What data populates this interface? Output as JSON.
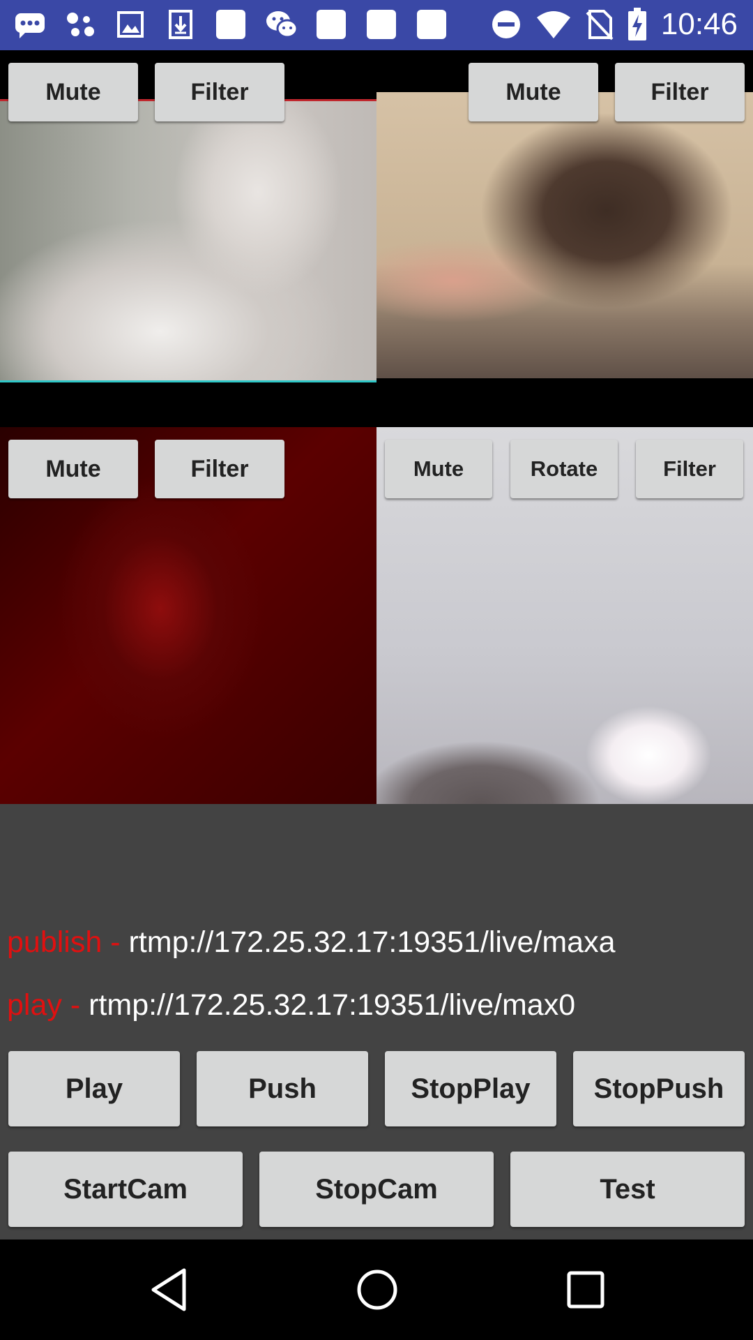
{
  "status_bar": {
    "time": "10:46",
    "left_icons": [
      "message-notification-icon",
      "google-assistant-icon",
      "gallery-icon",
      "download-icon",
      "blank-notification-icon",
      "wechat-icon",
      "blank-notification-icon",
      "blank-notification-icon",
      "blank-notification-icon"
    ],
    "right_icons": [
      "do-not-disturb-icon",
      "wifi-icon",
      "no-sim-icon",
      "battery-charging-icon"
    ]
  },
  "players": [
    {
      "buttons": [
        "Mute",
        "Filter"
      ]
    },
    {
      "buttons": [
        "Mute",
        "Filter"
      ]
    },
    {
      "buttons": [
        "Mute",
        "Filter"
      ]
    },
    {
      "buttons": [
        "Mute",
        "Rotate",
        "Filter"
      ]
    }
  ],
  "urls": {
    "publish_label": "publish - ",
    "publish_url": "rtmp://172.25.32.17:19351/live/maxa",
    "play_label": "play - ",
    "play_url": "rtmp://172.25.32.17:19351/live/max0"
  },
  "controls_row1": [
    "Play",
    "Push",
    "StopPlay",
    "StopPush"
  ],
  "controls_row2": [
    "StartCam",
    "StopCam",
    "Test"
  ],
  "nav_icons": [
    "back-icon",
    "home-icon",
    "recents-icon"
  ],
  "colors": {
    "status_bar": "#3a48a6",
    "background": "#434343",
    "accent_label": "#e01010"
  }
}
